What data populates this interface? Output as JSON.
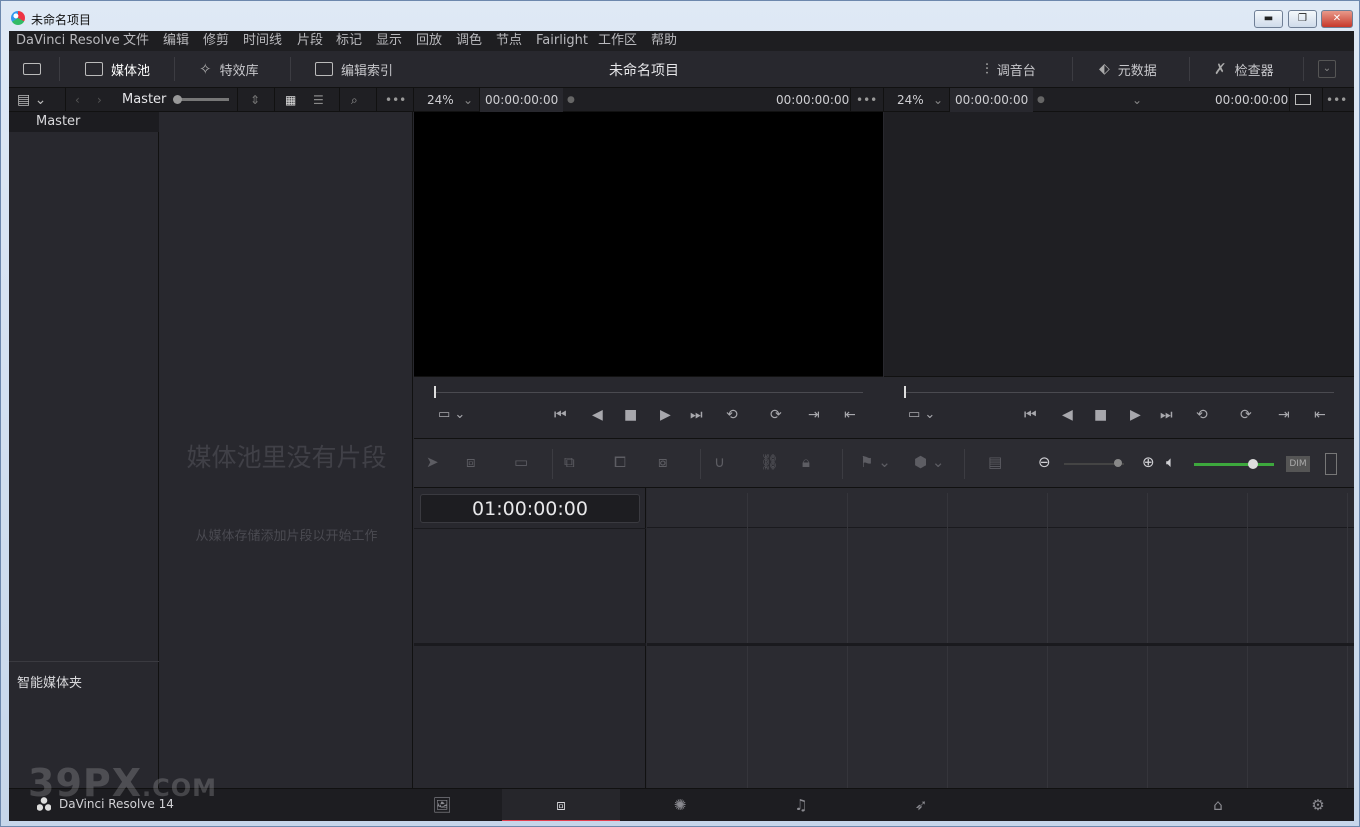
{
  "window": {
    "title": "未命名项目",
    "minimize": "▬",
    "maximize": "❐",
    "close": "✕"
  },
  "menu": [
    "DaVinci Resolve",
    "文件",
    "编辑",
    "修剪",
    "时间线",
    "片段",
    "标记",
    "显示",
    "回放",
    "调色",
    "节点",
    "Fairlight",
    "工作区",
    "帮助"
  ],
  "toolbar": {
    "media_pool": "媒体池",
    "effects_library": "特效库",
    "edit_index": "编辑索引",
    "project_title": "未命名项目",
    "mixer": "调音台",
    "metadata": "元数据",
    "inspector": "检查器"
  },
  "subbar": {
    "bin_name": "Master",
    "source_zoom": "24%",
    "source_tc_in": "00:00:00:00",
    "source_tc_out": "00:00:00:00",
    "timeline_zoom": "24%",
    "timeline_tc_in": "00:00:00:00",
    "timeline_tc_out": "00:00:00:00",
    "more": "•••"
  },
  "sidebar": {
    "master": "Master",
    "smart_bins": "智能媒体夹"
  },
  "media_pool": {
    "empty_title": "媒体池里没有片段",
    "empty_hint": "从媒体存储添加片段以开始工作"
  },
  "timeline": {
    "timecode": "01:00:00:00"
  },
  "edit_tools": {
    "dim_label": "DIM"
  },
  "bottom": {
    "brand": "DaVinci Resolve 14",
    "active_page": "edit"
  },
  "watermark": {
    "main": "39PX",
    "suffix": ".COM"
  },
  "colors": {
    "accent": "#e34050",
    "volume": "#3da83d",
    "panel": "#28282e"
  }
}
